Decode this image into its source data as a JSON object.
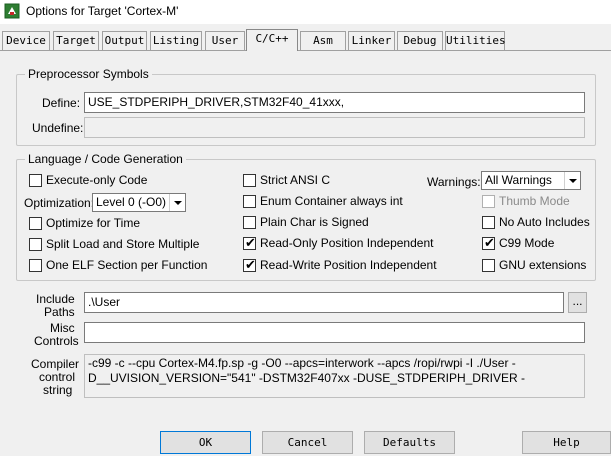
{
  "window": {
    "title": "Options for Target 'Cortex-M'",
    "icon": "uvision-icon"
  },
  "tabs": [
    {
      "label": "Device"
    },
    {
      "label": "Target"
    },
    {
      "label": "Output"
    },
    {
      "label": "Listing"
    },
    {
      "label": "User"
    },
    {
      "label": "C/C++"
    },
    {
      "label": "Asm"
    },
    {
      "label": "Linker"
    },
    {
      "label": "Debug"
    },
    {
      "label": "Utilities"
    }
  ],
  "active_tab": "C/C++",
  "preprocessor": {
    "group_title": "Preprocessor Symbols",
    "define_label": "Define:",
    "define_value": "USE_STDPERIPH_DRIVER,STM32F40_41xxx,",
    "undefine_label": "Undefine:",
    "undefine_value": ""
  },
  "codegen": {
    "group_title": "Language / Code Generation",
    "execute_only": {
      "label": "Execute-only Code",
      "checked": false
    },
    "optimization_label": "Optimization:",
    "optimization_value": "Level 0 (-O0)",
    "optimize_time": {
      "label": "Optimize for Time",
      "checked": false
    },
    "split_load": {
      "label": "Split Load and Store Multiple",
      "checked": false
    },
    "one_elf": {
      "label": "One ELF Section per Function",
      "checked": false
    },
    "strict_ansi": {
      "label": "Strict ANSI C",
      "checked": false
    },
    "enum_container": {
      "label": "Enum Container always int",
      "checked": false
    },
    "plain_char": {
      "label": "Plain Char is Signed",
      "checked": false
    },
    "ro_pi": {
      "label": "Read-Only Position Independent",
      "checked": true
    },
    "rw_pi": {
      "label": "Read-Write Position Independent",
      "checked": true
    },
    "warnings_label": "Warnings:",
    "warnings_value": "All Warnings",
    "thumb_mode": {
      "label": "Thumb Mode",
      "checked": false,
      "disabled": true
    },
    "no_auto_includes": {
      "label": "No Auto Includes",
      "checked": false
    },
    "c99_mode": {
      "label": "C99 Mode",
      "checked": true
    },
    "gnu_ext": {
      "label": "GNU extensions",
      "checked": false
    }
  },
  "paths": {
    "include_label_1": "Include",
    "include_label_2": "Paths",
    "include_value": ".\\User",
    "browse_label": "...",
    "misc_label_1": "Misc",
    "misc_label_2": "Controls",
    "misc_value": "",
    "compiler_label_1": "Compiler",
    "compiler_label_2": "control",
    "compiler_label_3": "string",
    "compiler_line_1": "-c99 -c --cpu Cortex-M4.fp.sp -g -O0 --apcs=interwork --apcs /ropi/rwpi -I ./User -",
    "compiler_line_2": "D__UVISION_VERSION=\"541\" -DSTM32F407xx -DUSE_STDPERIPH_DRIVER -"
  },
  "buttons": {
    "ok": "OK",
    "cancel": "Cancel",
    "defaults": "Defaults",
    "help": "Help"
  },
  "check_mark": "✔"
}
